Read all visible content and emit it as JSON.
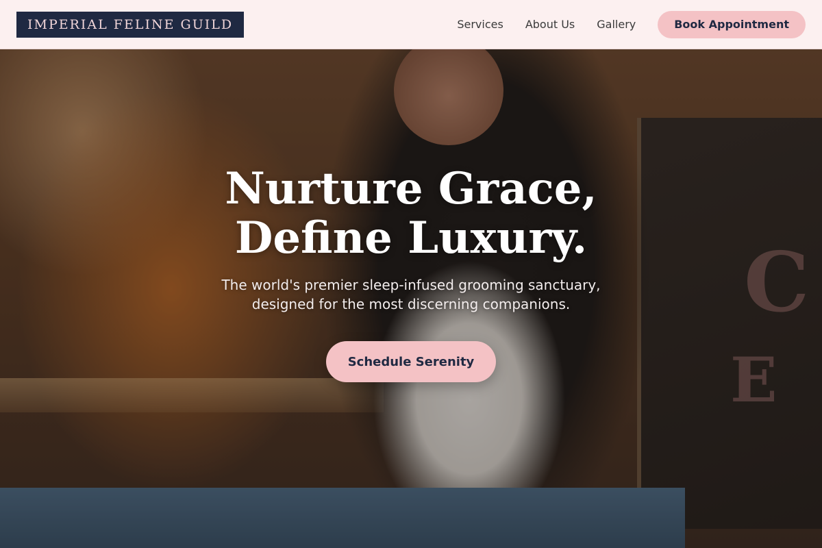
{
  "header": {
    "logo": "IMPERIAL FELINE GUILD",
    "nav": [
      "Services",
      "About Us",
      "Gallery"
    ],
    "cta": "Book Appointment"
  },
  "hero": {
    "title_line1": "Nurture Grace,",
    "title_line2": "Define Luxury.",
    "subtitle_line1": "The world's premier sleep-infused grooming sanctuary,",
    "subtitle_line2": "designed for the most discerning companions.",
    "cta": "Schedule Serenity",
    "chalk_top": "C",
    "chalk_bottom": "E"
  },
  "colors": {
    "accent_pink": "#f4c2c5",
    "navy": "#1f2942",
    "header_bg": "#fcf0f0"
  }
}
